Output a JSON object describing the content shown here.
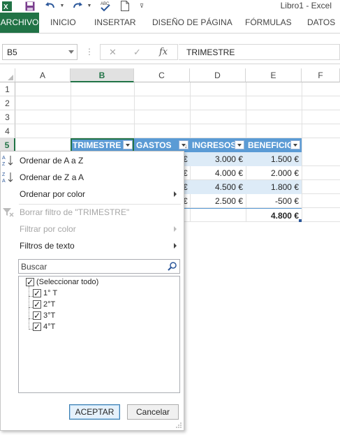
{
  "app": {
    "title": "Libro1 - Excel"
  },
  "ribbon": {
    "tabs": [
      "ARCHIVO",
      "INICIO",
      "INSERTAR",
      "DISEÑO DE PÁGINA",
      "FÓRMULAS",
      "DATOS"
    ]
  },
  "formula_bar": {
    "name_box": "B5",
    "fx_label": "fx",
    "cancel_glyph": "✕",
    "enter_glyph": "✓",
    "formula": "TRIMESTRE"
  },
  "grid": {
    "columns": [
      "A",
      "B",
      "C",
      "D",
      "E",
      "F"
    ],
    "rows": [
      "1",
      "2",
      "3",
      "4",
      "5"
    ],
    "selected_column": "B",
    "selected_row": "5",
    "table_headers": [
      "TRIMESTRE",
      "GASTOS",
      "INGRESOS",
      "BENEFICIO"
    ],
    "visible_cells": {
      "gastos_partial": [
        "€",
        "€",
        "€",
        "€"
      ],
      "ingresos": [
        "3.000 €",
        "4.000 €",
        "4.500 €",
        "2.500 €"
      ],
      "beneficio": [
        "1.500 €",
        "2.000 €",
        "1.800 €",
        "-500 €"
      ],
      "total_beneficio": "4.800 €"
    }
  },
  "filter_menu": {
    "items": {
      "sort_az": "Ordenar de A a Z",
      "sort_za": "Ordenar de Z a A",
      "sort_color": "Ordenar por color",
      "clear_filter": "Borrar filtro de \"TRIMESTRE\"",
      "filter_color": "Filtrar por color",
      "text_filters": "Filtros de texto"
    },
    "search_placeholder": "Buscar",
    "list": [
      "(Seleccionar todo)",
      "1° T",
      "2°T",
      "3°T",
      "4°T"
    ],
    "ok_label": "ACEPTAR",
    "cancel_label": "Cancelar"
  },
  "colors": {
    "excel_green": "#217346",
    "table_header": "#5b9bd5",
    "table_band": "#ddebf7"
  }
}
